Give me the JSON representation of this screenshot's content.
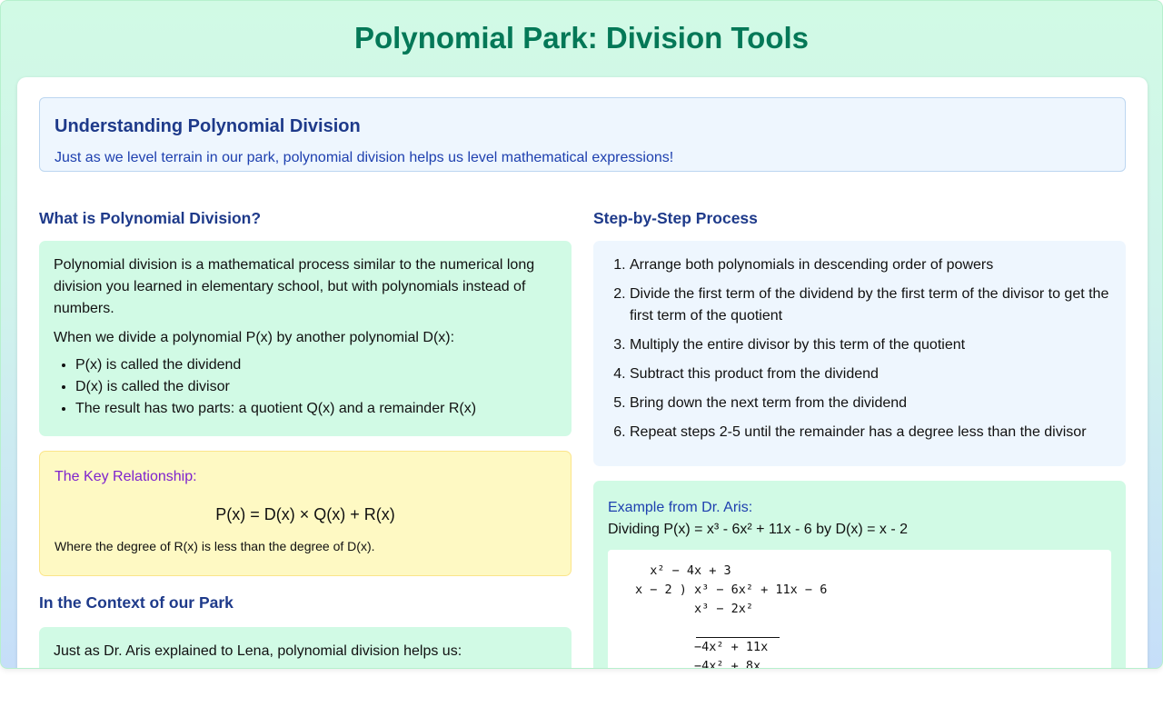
{
  "page": {
    "title": "Polynomial Park: Division Tools"
  },
  "intro": {
    "heading": "Understanding Polynomial Division",
    "text": "Just as we level terrain in our park, polynomial division helps us level mathematical expressions!"
  },
  "what_is": {
    "heading": "What is Polynomial Division?",
    "paragraph1": "Polynomial division is a mathematical process similar to the numerical long division you learned in elementary school, but with polynomials instead of numbers.",
    "paragraph2": "When we divide a polynomial P(x) by another polynomial D(x):",
    "items": [
      "P(x) is called the dividend",
      "D(x) is called the divisor",
      "The result has two parts: a quotient Q(x) and a remainder R(x)"
    ]
  },
  "key_relationship": {
    "label": "The Key Relationship:",
    "formula": "P(x) = D(x) × Q(x) + R(x)",
    "note": "Where the degree of R(x) is less than the degree of D(x)."
  },
  "context": {
    "heading": "In the Context of our Park",
    "text": "Just as Dr. Aris explained to Lena, polynomial division helps us:"
  },
  "steps": {
    "heading": "Step-by-Step Process",
    "items": [
      "Arrange both polynomials in descending order of powers",
      "Divide the first term of the dividend by the first term of the divisor to get the first term of the quotient",
      "Multiply the entire divisor by this term of the quotient",
      "Subtract this product from the dividend",
      "Bring down the next term from the dividend",
      "Repeat steps 2-5 until the remainder has a degree less than the divisor"
    ]
  },
  "example": {
    "label": "Example from Dr. Aris:",
    "statement": "Dividing P(x) = x³ - 6x² + 11x - 6 by D(x) = x - 2",
    "work": {
      "quotient": "  x² − 4x + 3",
      "division": "x − 2 ) x³ − 6x² + 11x − 6",
      "subtract1": "        x³ − 2x²",
      "remainder1": "        −4x² + 11x",
      "subtract2": "        −4x² + 8x"
    }
  }
}
